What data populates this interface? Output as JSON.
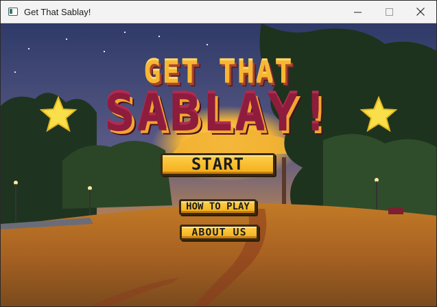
{
  "window": {
    "title": "Get That Sablay!",
    "icons": {
      "app": "app-window-icon",
      "minimize": "minimize-icon",
      "maximize": "maximize-icon",
      "close": "close-icon"
    }
  },
  "game": {
    "logo": {
      "line1": "GET THAT",
      "line2": "SABLAY!"
    },
    "decorations": [
      "star-icon",
      "star-icon"
    ],
    "menu": {
      "start_label": "START",
      "how_to_play_label": "HOW TO PLAY",
      "about_us_label": "ABOUT US"
    }
  },
  "colors": {
    "accent_gold": "#f7b733",
    "logo_maroon": "#8e1c3c",
    "button_yellow": "#ffcf4a",
    "sky": "#3b4a78",
    "field": "#b8742a"
  }
}
